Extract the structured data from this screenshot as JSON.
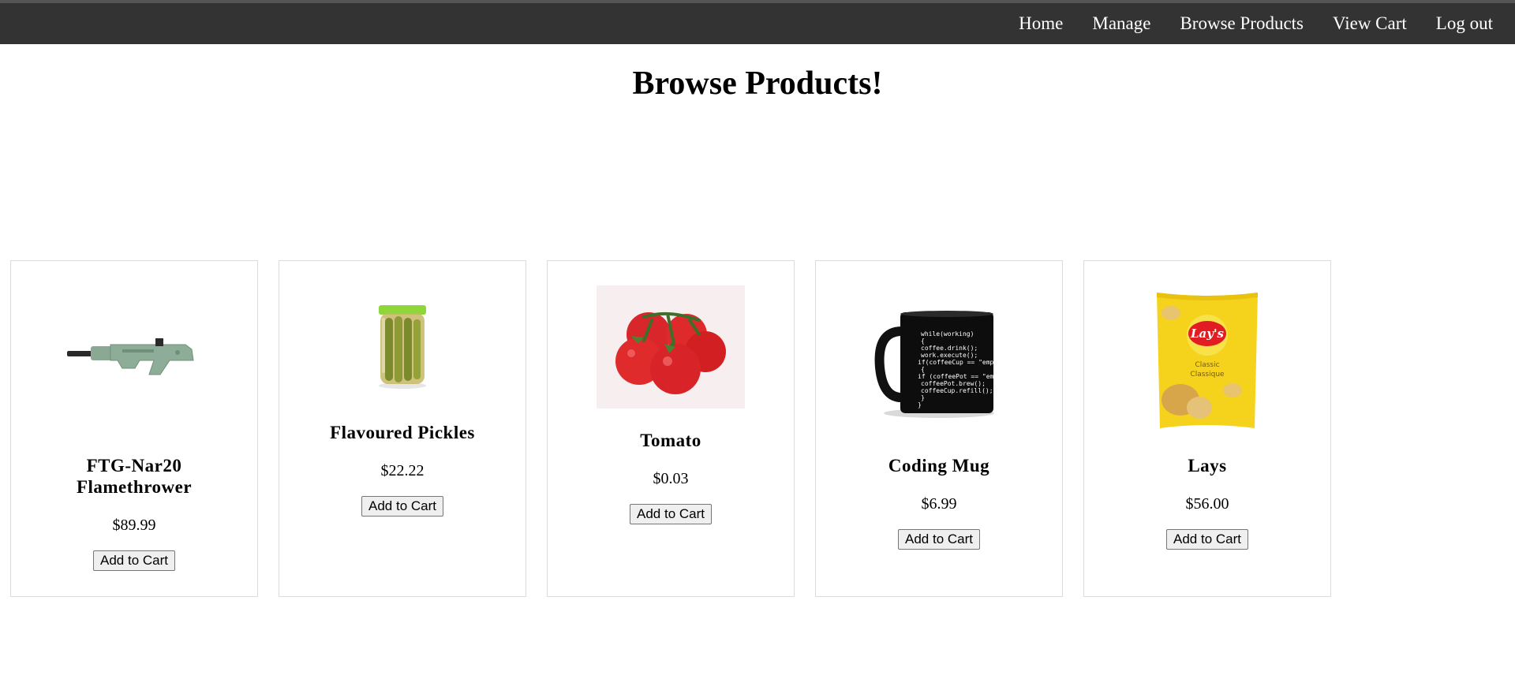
{
  "nav": {
    "items": [
      {
        "label": "Home"
      },
      {
        "label": "Manage"
      },
      {
        "label": "Browse Products"
      },
      {
        "label": "View Cart"
      },
      {
        "label": "Log out"
      }
    ]
  },
  "page": {
    "title": "Browse Products!"
  },
  "products": [
    {
      "name": "FTG-Nar20 Flamethrower",
      "price": "$89.99",
      "button": "Add to Cart",
      "image": "flamethrower-image"
    },
    {
      "name": "Flavoured Pickles",
      "price": "$22.22",
      "button": "Add to Cart",
      "image": "pickle-jar-image"
    },
    {
      "name": "Tomato",
      "price": "$0.03",
      "button": "Add to Cart",
      "image": "tomato-image"
    },
    {
      "name": "Coding Mug",
      "price": "$6.99",
      "button": "Add to Cart",
      "image": "coding-mug-image",
      "mug_text": [
        "while(working)",
        "{",
        "  coffee.drink();",
        "  work.execute();",
        "if(coffeeCup == \"empty\")",
        "{",
        "  if (coffeePot == \"empty\")",
        "    coffeePot.brew();",
        "  coffeeCup.refill();",
        "}",
        "}"
      ]
    },
    {
      "name": "Lays",
      "price": "$56.00",
      "button": "Add to Cart",
      "image": "lays-chips-image",
      "bag_text": {
        "brand": "Lay's",
        "line1": "Classic",
        "line2": "Classique"
      }
    }
  ],
  "colors": {
    "navbar": "#333333",
    "nav_text": "#ffffff",
    "card_border": "#dcdcdc"
  }
}
